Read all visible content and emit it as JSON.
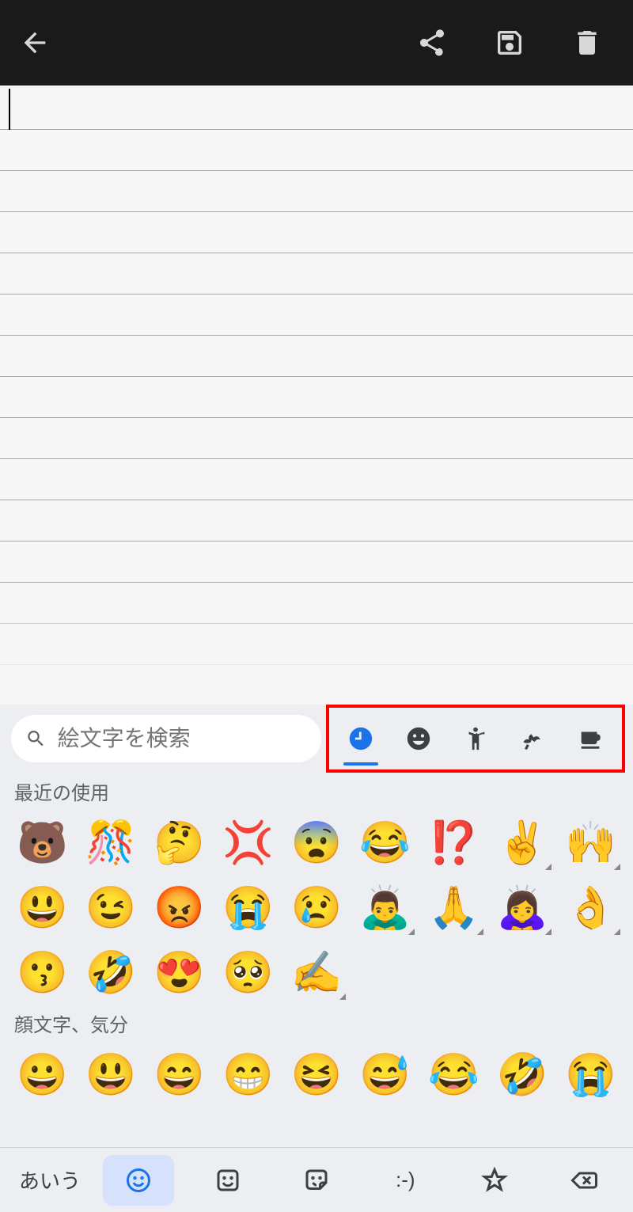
{
  "topbar": {
    "back_icon": "arrow-left",
    "share_icon": "share",
    "save_icon": "save",
    "delete_icon": "trash"
  },
  "note": {
    "content": ""
  },
  "keyboard": {
    "search_placeholder": "絵文字を検索",
    "category_tabs": [
      {
        "id": "recent",
        "icon": "clock",
        "active": true
      },
      {
        "id": "smileys",
        "icon": "smiley",
        "active": false
      },
      {
        "id": "people",
        "icon": "person",
        "active": false
      },
      {
        "id": "nature",
        "icon": "nature",
        "active": false
      },
      {
        "id": "food",
        "icon": "food",
        "active": false
      }
    ],
    "sections": {
      "recent_label": "最近の使用",
      "recent_emojis": [
        "🐻",
        "🎊",
        "🤔",
        "💢",
        "😨",
        "😂",
        "⁉️",
        "✌️",
        "🙌",
        "😃",
        "😉",
        "😡",
        "😭",
        "😢",
        "🙇‍♂️",
        "🙏",
        "🙇‍♀️",
        "👌",
        "😗",
        "🤣",
        "😍",
        "🥺",
        "✍️"
      ],
      "smileys_label": "顔文字、気分",
      "smileys_emojis": [
        "😀",
        "😃",
        "😄",
        "😁",
        "😆",
        "😅",
        "😂",
        "🤣",
        "😭"
      ]
    },
    "bottom": {
      "abc_label": "あいう",
      "emoji_icon": "smiley-outline",
      "sticker_icon": "sticker",
      "gif_icon": "gif-sticker",
      "kaomoji_label": ":-)",
      "star_icon": "star",
      "backspace_icon": "backspace"
    }
  }
}
